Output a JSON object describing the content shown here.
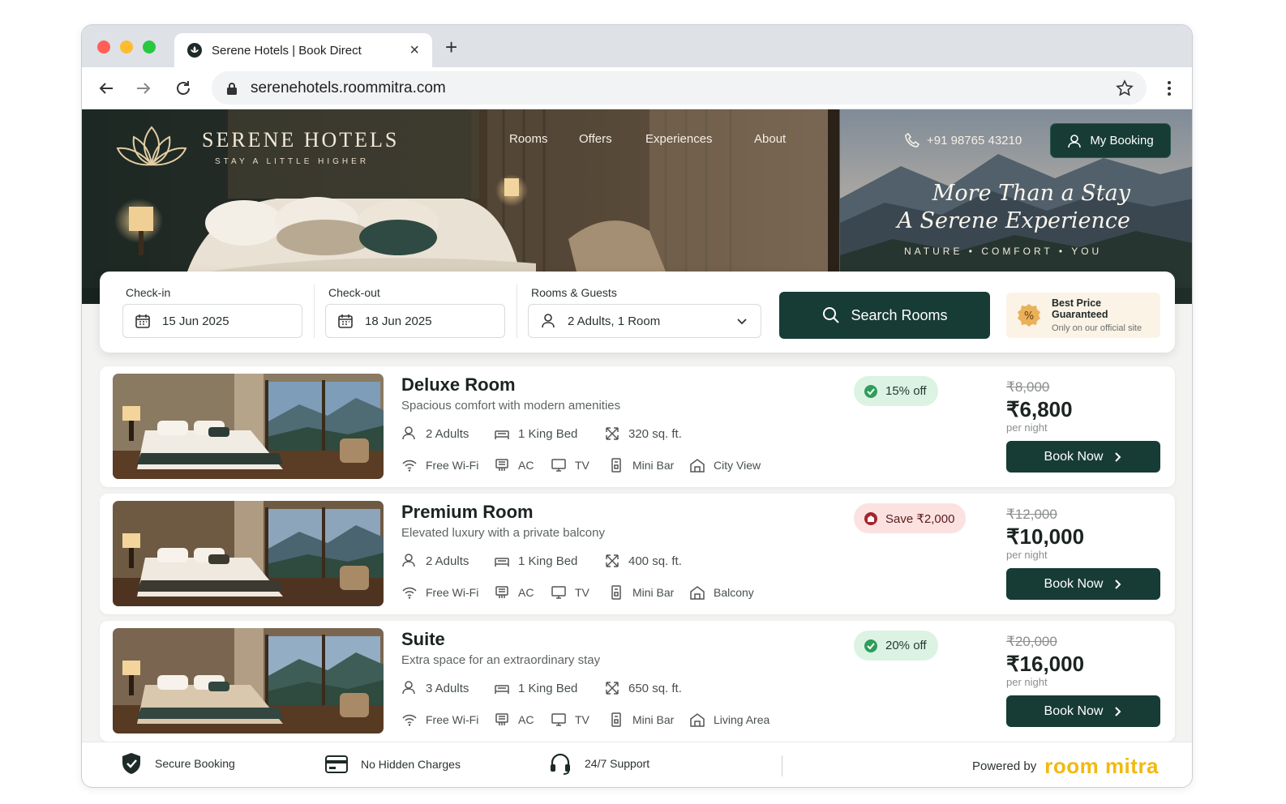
{
  "browser": {
    "tab_title": "Serene Hotels | Book Direct",
    "url": "serenehotels.roommitra.com"
  },
  "header": {
    "brand": "SERENE HOTELS",
    "tagline": "STAY A LITTLE HIGHER",
    "nav": [
      "Rooms",
      "Offers",
      "Experiences",
      "About"
    ],
    "phone": "+91 98765 43210",
    "my_booking": "My Booking",
    "headline_1": "More Than a Stay",
    "headline_2": "A Serene Experience",
    "subline": "NATURE • COMFORT • YOU"
  },
  "search": {
    "checkin_label": "Check-in",
    "checkin_value": "15 Jun 2025",
    "checkout_label": "Check-out",
    "checkout_value": "18 Jun 2025",
    "guests_label": "Rooms & Guests",
    "guests_value": "2 Adults, 1 Room",
    "button": "Search Rooms",
    "guarantee_title": "Best Price Guaranteed",
    "guarantee_sub": "Only on our official site"
  },
  "rooms": [
    {
      "name": "Deluxe Room",
      "desc": "Spacious comfort with modern amenities",
      "adults": "2 Adults",
      "bed": "1 King Bed",
      "size": "320 sq. ft.",
      "wifi": "Free Wi-Fi",
      "ac": "AC",
      "tv": "TV",
      "minibar": "Mini Bar",
      "extra": "City View",
      "badge": "15% off",
      "badge_type": "green",
      "old_price": "₹8,000",
      "price": "₹6,800",
      "per": "per night",
      "cta": "Book Now"
    },
    {
      "name": "Premium Room",
      "desc": "Elevated luxury with a private balcony",
      "adults": "2 Adults",
      "bed": "1 King Bed",
      "size": "400 sq. ft.",
      "wifi": "Free Wi-Fi",
      "ac": "AC",
      "tv": "TV",
      "minibar": "Mini Bar",
      "extra": "Balcony",
      "badge": "Save ₹2,000",
      "badge_type": "red",
      "old_price": "₹12,000",
      "price": "₹10,000",
      "per": "per night",
      "cta": "Book Now"
    },
    {
      "name": "Suite",
      "desc": "Extra space for an extraordinary stay",
      "adults": "3 Adults",
      "bed": "1 King Bed",
      "size": "650 sq. ft.",
      "wifi": "Free Wi-Fi",
      "ac": "AC",
      "tv": "TV",
      "minibar": "Mini Bar",
      "extra": "Living Area",
      "badge": "20% off",
      "badge_type": "green",
      "old_price": "₹20,000",
      "price": "₹16,000",
      "per": "per night",
      "cta": "Book Now"
    }
  ],
  "footer": {
    "secure": "Secure Booking",
    "charges": "No Hidden Charges",
    "support": "24/7 Support",
    "powered": "Powered by",
    "provider": "room mitra"
  },
  "colors": {
    "brand_dark": "#173b35",
    "badge_green_bg": "#dcf3e4",
    "badge_green": "#2f9e58",
    "badge_red_bg": "#fbe2e0",
    "badge_red": "#a3262b",
    "accent_gold": "#f2b90f"
  }
}
